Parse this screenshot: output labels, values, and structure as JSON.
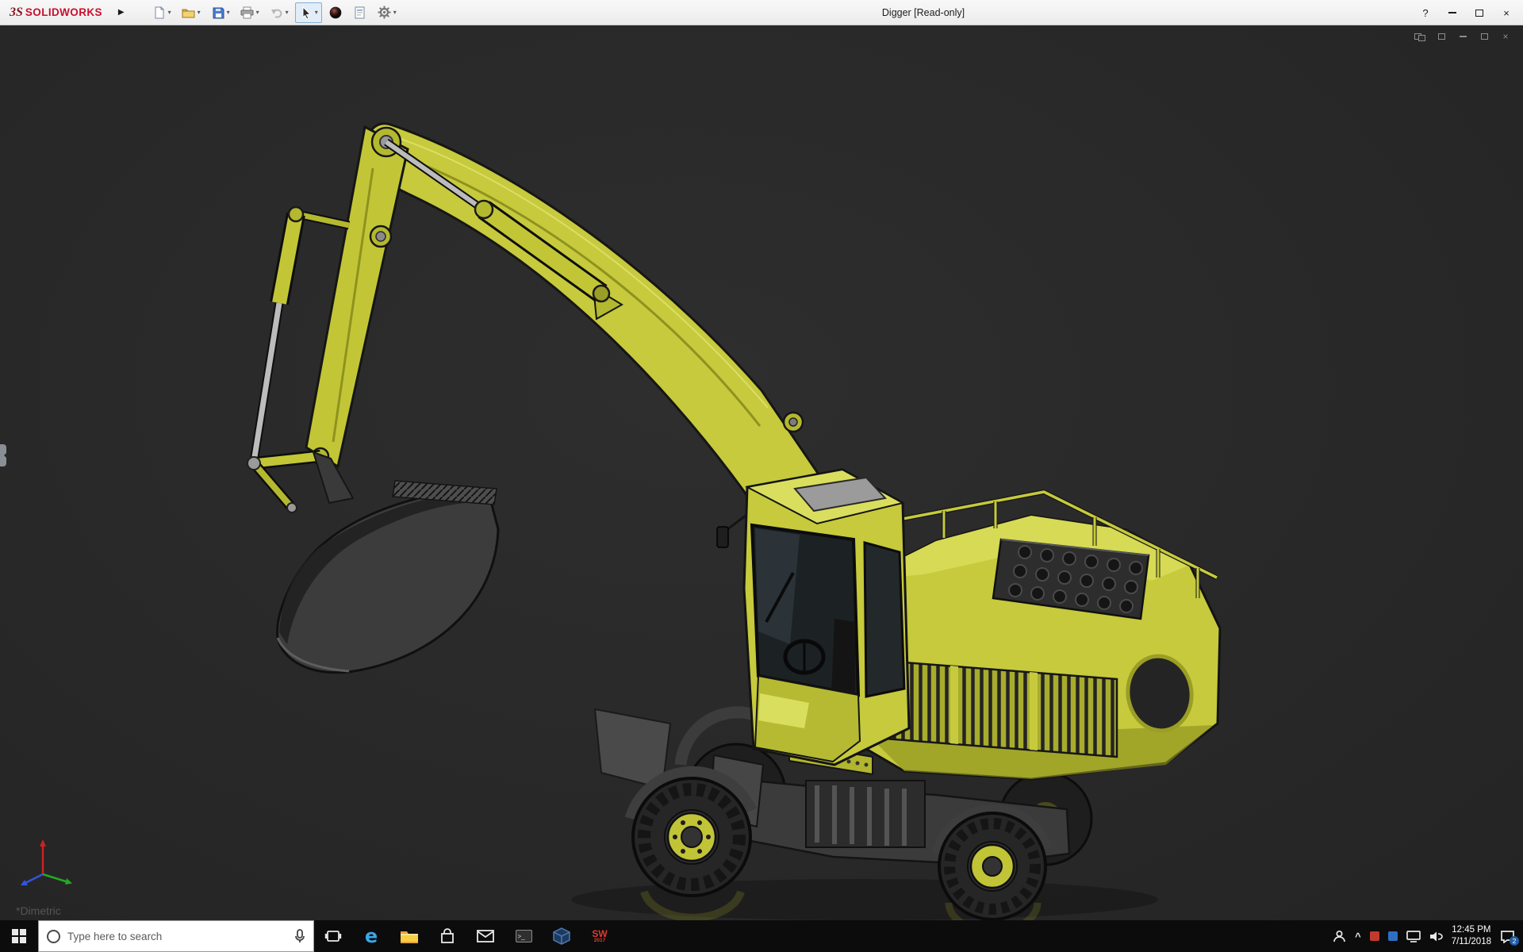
{
  "titlebar": {
    "logo_mark": "3S",
    "logo_text": "SOLIDWORKS",
    "expand_glyph": "▶",
    "doc_title": "Digger [Read-only]",
    "help_glyph": "?",
    "close_glyph": "×"
  },
  "toolbar": {
    "dropdown_glyph": "▾",
    "tools": [
      {
        "name": "new-document",
        "dropdown": true
      },
      {
        "name": "open-document",
        "dropdown": true
      },
      {
        "name": "save",
        "dropdown": true
      },
      {
        "name": "print",
        "dropdown": true
      },
      {
        "name": "undo",
        "dropdown": true
      },
      {
        "name": "select",
        "dropdown": true,
        "active": true
      },
      {
        "name": "appearance-sphere",
        "dropdown": false
      },
      {
        "name": "design-binder",
        "dropdown": false
      },
      {
        "name": "options",
        "dropdown": true
      }
    ]
  },
  "document_window": {
    "controls": [
      "window-cascade",
      "window-new",
      "minimize",
      "restore",
      "close"
    ]
  },
  "viewport": {
    "orientation_label": "*Dimetric"
  },
  "taskbar": {
    "search_placeholder": "Type here to search",
    "edge_glyph": "e",
    "console_glyph": ">_",
    "sw_label": "SW",
    "sw_year": "2017",
    "tray_chevron": "^",
    "time": "12:45 PM",
    "date": "7/11/2018",
    "action_badge": "2"
  },
  "colors": {
    "excavator_yellow": "#c6ca3c",
    "excavator_shade": "#8e921f",
    "titlebar_bg": "#f1f1f1",
    "viewport_bg": "#2a2a2a",
    "taskbar_bg": "#0c0c0c",
    "logo_red": "#c8102e"
  }
}
